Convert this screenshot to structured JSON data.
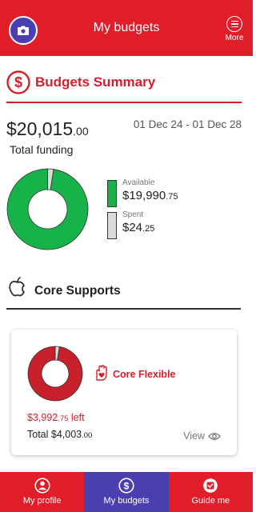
{
  "header": {
    "title": "My budgets",
    "more_label": "More",
    "left_icon": "camera-icon"
  },
  "summary": {
    "title": "Budgets Summary",
    "total_main": "$20,015",
    "total_cents": ".00",
    "total_label": "Total funding",
    "date_range": "01 Dec 24 - 01 Dec 28",
    "available": {
      "label": "Available",
      "main": "$19,990",
      "cents": ".75",
      "value": 19990.75,
      "color": "#18b24a"
    },
    "spent": {
      "label": "Spent",
      "main": "$24",
      "cents": ".25",
      "value": 24.25,
      "color": "#d9dcdb"
    }
  },
  "core": {
    "title": "Core Supports",
    "card": {
      "title": "Core Flexible",
      "left_main": "$3,992",
      "left_cents": ".75",
      "left_suffix": " left",
      "total_prefix": "Total ",
      "total_main": "$4,003",
      "total_cents": ".00",
      "view_label": "View",
      "remaining_value": 3992.75,
      "total_value": 4003.0,
      "remaining_color": "#c8202a",
      "spent_color": "#d9dcdb"
    }
  },
  "nav": {
    "items": [
      {
        "label": "My profile",
        "icon": "profile-icon"
      },
      {
        "label": "My budgets",
        "icon": "dollar-icon"
      },
      {
        "label": "Guide me",
        "icon": "checkbox-icon"
      }
    ],
    "active_index": 1
  },
  "colors": {
    "brand_red": "#e11d2a",
    "accent_purple": "#4a3fb0"
  }
}
